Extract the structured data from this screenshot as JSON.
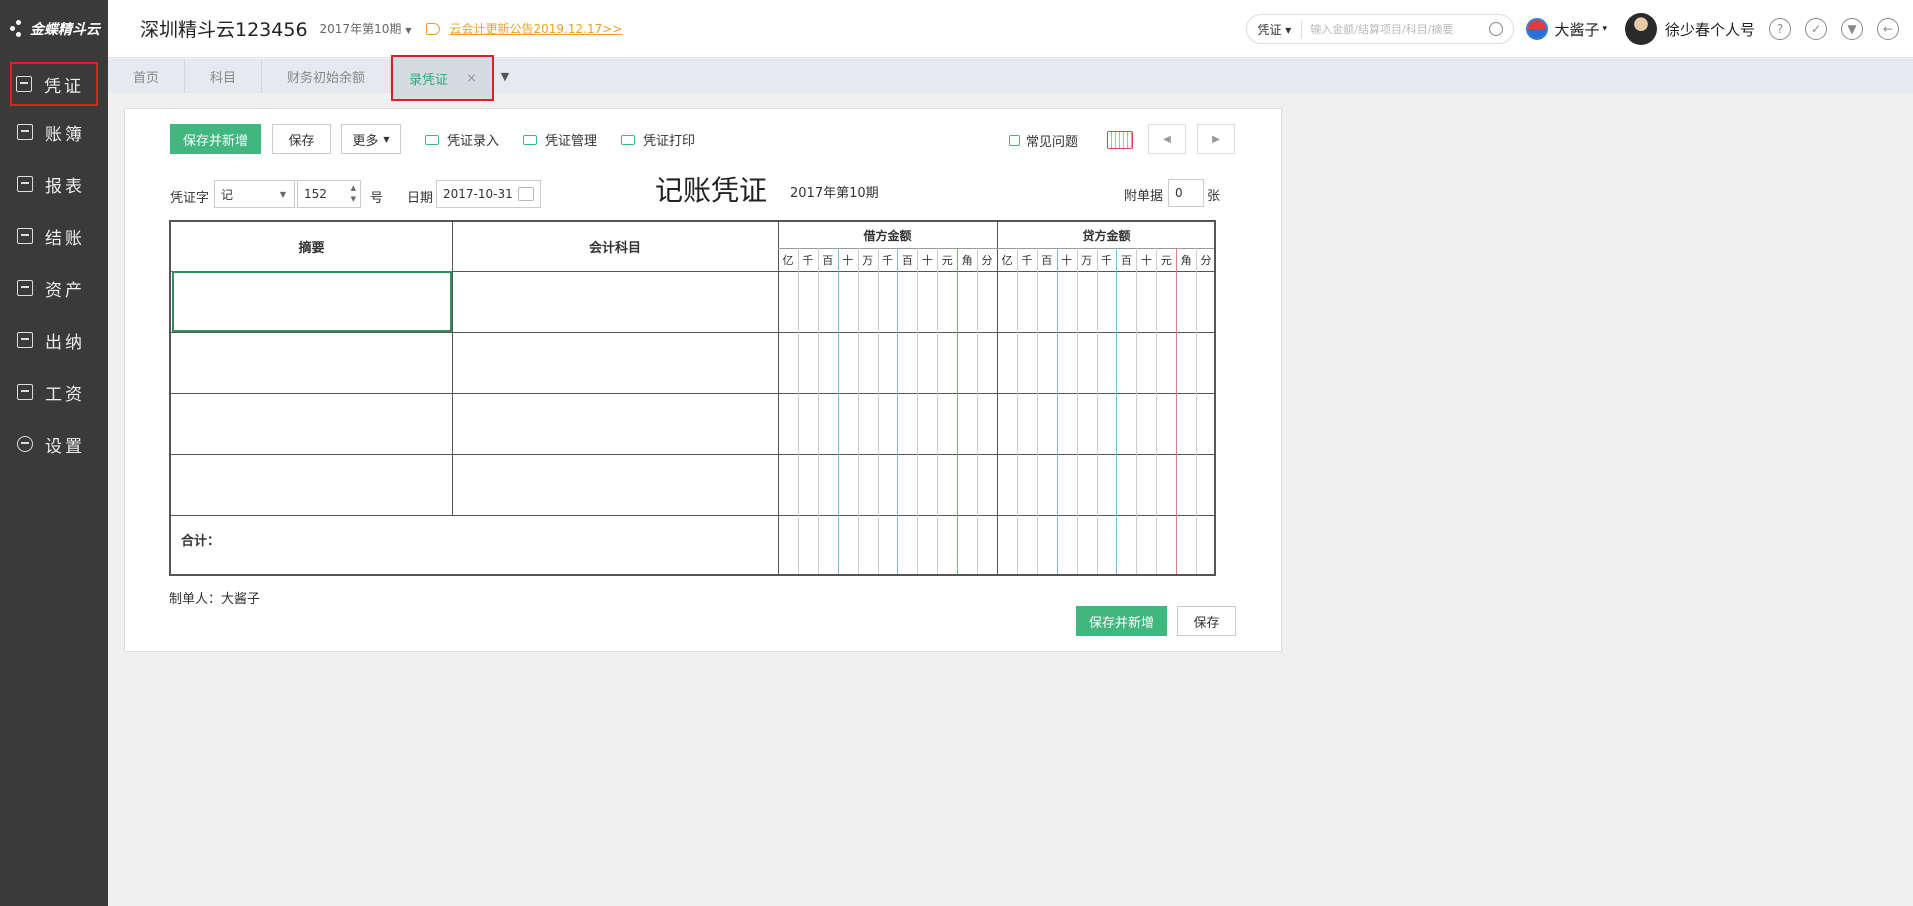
{
  "sidebar": {
    "logo": "金蝶精斗云",
    "items": [
      {
        "label": "凭证",
        "icon": "voucher-icon"
      },
      {
        "label": "账簿",
        "icon": "ledger-icon"
      },
      {
        "label": "报表",
        "icon": "report-icon"
      },
      {
        "label": "结账",
        "icon": "close-period-icon"
      },
      {
        "label": "资产",
        "icon": "asset-icon"
      },
      {
        "label": "出纳",
        "icon": "cashier-icon"
      },
      {
        "label": "工资",
        "icon": "salary-icon"
      },
      {
        "label": "设置",
        "icon": "gear-icon"
      }
    ]
  },
  "header": {
    "company": "深圳精斗云123456",
    "period": "2017年第10期",
    "notice": "云会计更新公告2019.12.17>>",
    "search_scope": "凭证",
    "search_placeholder": "输入金额/结算项目/科目/摘要",
    "user1": "大酱子",
    "user2": "徐少春个人号"
  },
  "tabs": [
    {
      "label": "首页"
    },
    {
      "label": "科目"
    },
    {
      "label": "财务初始余额"
    },
    {
      "label": "录凭证",
      "close": "×"
    }
  ],
  "toolbar": {
    "save_new": "保存并新增",
    "save": "保存",
    "more": "更多",
    "entry": "凭证录入",
    "manage": "凭证管理",
    "print": "凭证打印",
    "faq": "常见问题"
  },
  "form": {
    "voucher_word_label": "凭证字",
    "voucher_word": "记",
    "voucher_no": "152",
    "no_suffix": "号",
    "date_label": "日期",
    "date": "2017-10-31",
    "title": "记账凭证",
    "period": "2017年第10期",
    "attach_label": "附单据",
    "attach_count": "0",
    "attach_unit": "张"
  },
  "table": {
    "col_summary": "摘要",
    "col_account": "会计科目",
    "col_debit": "借方金额",
    "col_credit": "贷方金额",
    "units": [
      "亿",
      "千",
      "百",
      "十",
      "万",
      "千",
      "百",
      "十",
      "元",
      "角",
      "分"
    ],
    "total_label": "合计："
  },
  "footer": {
    "maker": "制单人：大酱子",
    "save_new": "保存并新增",
    "save": "保存"
  }
}
